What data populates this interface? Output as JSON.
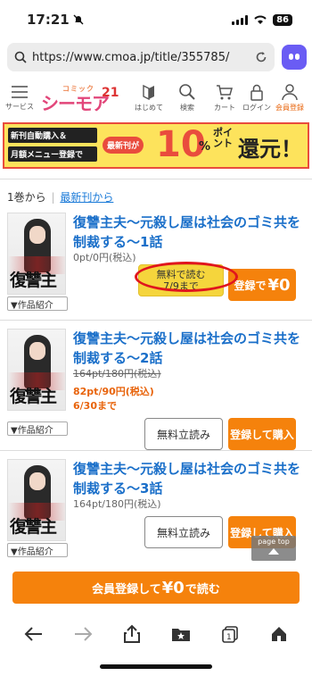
{
  "status": {
    "time": "17:21",
    "battery": "86"
  },
  "browser": {
    "url": "https://www.cmoa.jp/title/355785/"
  },
  "header": {
    "menu_label": "サービス",
    "logo_top": "コミック",
    "logo_main": "シーモア",
    "logo_num": "21",
    "nav": [
      {
        "label": "はじめて"
      },
      {
        "label": "検索"
      },
      {
        "label": "カート"
      },
      {
        "label": "ログイン"
      },
      {
        "label": "会員登録"
      }
    ]
  },
  "banner": {
    "line1": "新刊自動購入＆",
    "line2": "月額メニュー登録で",
    "badge": "最新刊が",
    "number": "10",
    "percent": "%",
    "point": "ポイント",
    "refund": "還元！"
  },
  "order": {
    "from_first": "1巻から",
    "separator": "|",
    "from_latest": "最新刊から"
  },
  "volumes": [
    {
      "title": "復讐主夫～元殺し屋は社会のゴミ共を制裁する～1話",
      "price": "0pt/0円(税込)",
      "intro": "▼作品紹介",
      "free_btn_line1": "無料で読む",
      "free_btn_line2": "7/9まで",
      "buy_btn": "登録で",
      "buy_btn_big": "¥0"
    },
    {
      "title": "復讐主夫～元殺し屋は社会のゴミ共を制裁する～2話",
      "price_old": "164pt/180円(税込)",
      "price_sale": "82pt/90円(税込)",
      "sale_until": "6/30まで",
      "intro": "▼作品紹介",
      "free_btn": "無料立読み",
      "buy_btn": "登録して購入"
    },
    {
      "title": "復讐主夫～元殺し屋は社会のゴミ共を制裁する～3話",
      "price": "164pt/180円(税込)",
      "intro": "▼作品紹介",
      "free_btn": "無料立読み",
      "buy_btn": "登録して購入"
    }
  ],
  "cover_title": "復讐主夫",
  "page_top": "page top",
  "bottom_cta": {
    "pre": "会員登録して",
    "big": "¥0",
    "post": "で読む"
  },
  "colors": {
    "link": "#1a6fc9",
    "accent": "#f5820c",
    "highlight": "#e0161d"
  }
}
